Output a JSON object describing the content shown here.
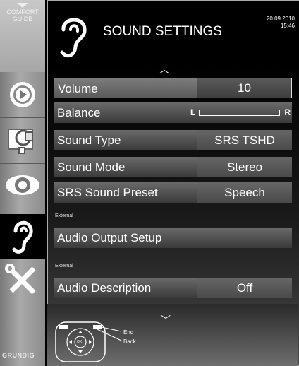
{
  "app": {
    "title": "SOUND SETTINGS",
    "date": "20.09.2010",
    "time": "15:46",
    "brand": "GRUNDIG"
  },
  "sidebar": {
    "comfort_line1": "COMFORT",
    "comfort_line2": "GUIDE",
    "items": [
      {
        "name": "picture-settings",
        "icon": "play-disc-icon"
      },
      {
        "name": "source-settings",
        "icon": "satellite-dish-icon"
      },
      {
        "name": "view-settings",
        "icon": "eye-icon"
      },
      {
        "name": "sound-settings",
        "icon": "ear-icon",
        "active": true
      },
      {
        "name": "tools-settings",
        "icon": "wrench-screwdriver-icon"
      }
    ]
  },
  "menu": {
    "volume": {
      "label": "Volume",
      "value": "10"
    },
    "balance": {
      "label": "Balance",
      "left": "L",
      "right": "R",
      "position": 0.5
    },
    "sound_type": {
      "label": "Sound Type",
      "value": "SRS TSHD"
    },
    "sound_mode": {
      "label": "Sound Mode",
      "value": "Stereo"
    },
    "srs_preset": {
      "label": "SRS Sound Preset",
      "value": "Speech"
    },
    "external_1": "External",
    "audio_output": {
      "label": "Audio Output Setup"
    },
    "external_2": "External",
    "audio_desc": {
      "label": "Audio Description",
      "value": "Off"
    }
  },
  "legend": {
    "end": "End",
    "back": "Back",
    "ok": "OK"
  },
  "colors": {
    "accent": "#ffffff",
    "rail": "#a9a9a9",
    "row": "#5a5a5a"
  }
}
